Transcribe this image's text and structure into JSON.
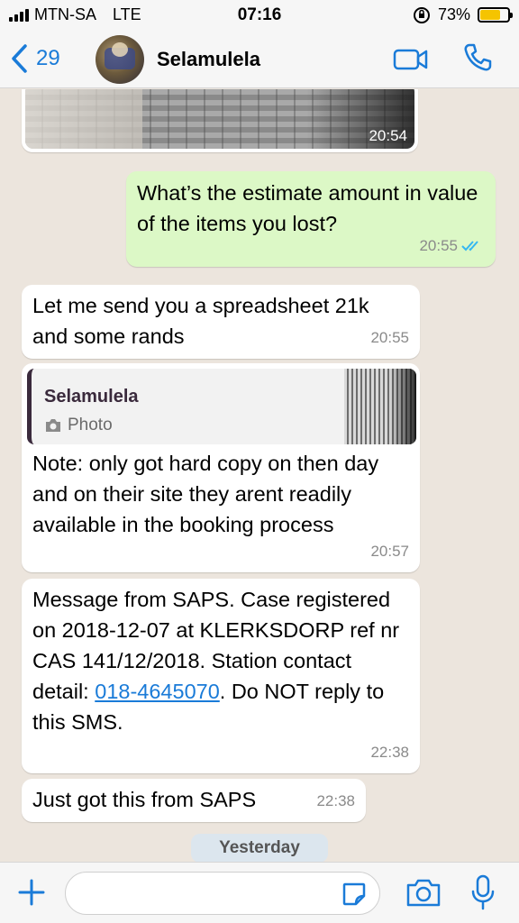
{
  "status_bar": {
    "carrier": "MTN-SA",
    "network": "LTE",
    "time": "07:16",
    "battery": "73%",
    "battery_level": 0.73
  },
  "header": {
    "back_count": "29",
    "contact_name": "Selamulela"
  },
  "messages": [
    {
      "type": "image",
      "direction": "incoming",
      "time": "20:54"
    },
    {
      "type": "text",
      "direction": "outgoing",
      "text": "What’s the estimate amount in value of the items you lost?",
      "time": "20:55",
      "status": "read"
    },
    {
      "type": "text",
      "direction": "incoming",
      "text": "Let me send you a spreadsheet 21k and some rands",
      "time": "20:55"
    },
    {
      "type": "reply",
      "direction": "incoming",
      "quote": {
        "author": "Selamulela",
        "kind": "Photo"
      },
      "text": "Note: only got hard copy on then day and on their site they arent readily available in the booking process",
      "time": "20:57"
    },
    {
      "type": "text",
      "direction": "incoming",
      "text_before_link": "Message from SAPS. Case registered on 2018-12-07 at KLERKSDORP ref nr CAS 141/12/2018. Station contact detail: ",
      "link": "018-4645070",
      "text_after_link": ". Do NOT reply to this SMS.",
      "time": "22:38"
    },
    {
      "type": "text",
      "direction": "incoming",
      "text": "Just got this from SAPS",
      "time": "22:38"
    }
  ],
  "date_separator": "Yesterday",
  "input_bar": {
    "placeholder": "",
    "value": ""
  },
  "colors": {
    "accent": "#1a7bd8",
    "outgoing_bubble": "#dcf8c6",
    "incoming_bubble": "#ffffff",
    "chat_background": "#ece5dd",
    "battery": "#f5c400"
  }
}
